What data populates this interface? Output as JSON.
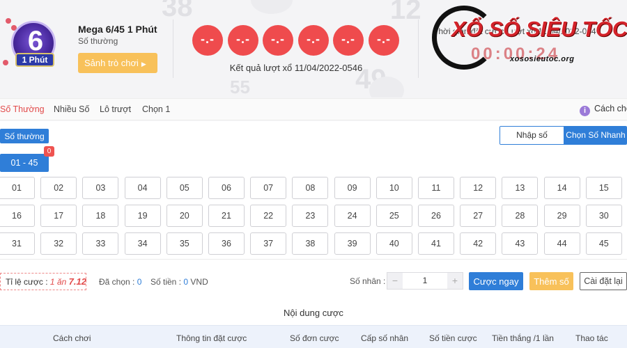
{
  "header": {
    "logo_tag": "1 Phút",
    "logo_number": "6",
    "game_name": "Mega 6/45 1 Phút",
    "game_type": "Số thường",
    "lobby_button": "Sảnh trò chơi",
    "balls": [
      "-.-",
      "-.-",
      "-.-",
      "-.-",
      "-.-",
      "-.-"
    ],
    "draw_result": "Kết quả lượt xổ 11/04/2022-0546",
    "countdown_label": "Thời gian đặt cược Lượt xổ 11/04/2022-0547",
    "countdown": "00:00:24",
    "watermark_title": "XỔ SỐ SIÊU TỐC",
    "watermark_site": "xososieutoc.org",
    "decor_numbers": [
      "38",
      "12",
      "55",
      "49"
    ]
  },
  "tabs": [
    "Số Thường",
    "Nhiều Số",
    "Lô trượt",
    "Chọn 1"
  ],
  "help": {
    "icon": "i",
    "label": "Cách chơi"
  },
  "main": {
    "mode_button": "Số thường",
    "segment": [
      "Nhập số",
      "Chọn Số Nhanh"
    ],
    "range_button": "01 - 45",
    "range_badge": "0",
    "numbers": [
      "01",
      "02",
      "03",
      "04",
      "05",
      "06",
      "07",
      "08",
      "09",
      "10",
      "11",
      "12",
      "13",
      "14",
      "15",
      "16",
      "17",
      "18",
      "19",
      "20",
      "21",
      "22",
      "23",
      "24",
      "25",
      "26",
      "27",
      "28",
      "29",
      "30",
      "31",
      "32",
      "33",
      "34",
      "35",
      "36",
      "37",
      "38",
      "39",
      "40",
      "41",
      "42",
      "43",
      "44",
      "45"
    ]
  },
  "footer": {
    "odds_label": "Tỉ lệ cược : ",
    "odds_one": "1",
    "odds_an": " ăn ",
    "odds_value": "7.12",
    "selected_label": "Đã chọn : ",
    "selected_value": "0",
    "amount_label": "Số tiền : ",
    "amount_value": "0",
    "amount_unit": " VND",
    "multiplier_label": "Số nhân :",
    "multiplier_value": "1",
    "minus": "−",
    "plus": "+",
    "bet_now": "Cược ngay",
    "add_number": "Thêm số",
    "reset": "Cài đặt lại"
  },
  "bet_content": {
    "title": "Nội dung cược",
    "columns": [
      "Cách chơi",
      "Thông tin đặt cược",
      "Số đơn cược",
      "Cấp số nhân",
      "Số tiền cược",
      "Tiền thắng /1 lần",
      "Thao tác"
    ]
  },
  "colors": {
    "primary_blue": "#2f7ed8",
    "ball_red": "#ef4b4d",
    "accent_orange": "#f8c15a",
    "active_tab_red": "#e24b4b"
  }
}
